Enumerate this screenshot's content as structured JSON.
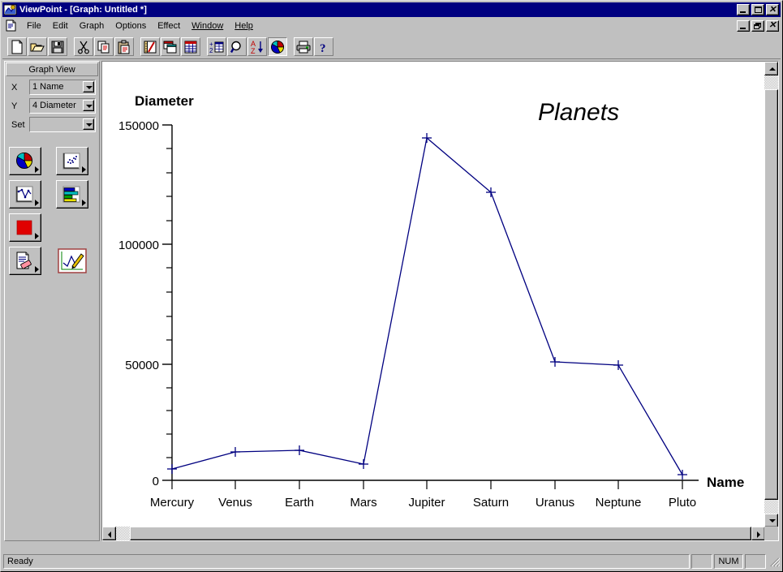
{
  "window": {
    "app_title": "ViewPoint - [Graph: Untitled *]",
    "app_icon": "viewpoint-app-icon",
    "minimize_label": "",
    "maximize_label": "",
    "close_label": "✕"
  },
  "menubar": {
    "document_icon": "document-icon",
    "items": [
      {
        "label": "File",
        "mnemonic": "F"
      },
      {
        "label": "Edit",
        "mnemonic": "E"
      },
      {
        "label": "Graph",
        "mnemonic": "G"
      },
      {
        "label": "Options",
        "mnemonic": "O"
      },
      {
        "label": "Effect",
        "mnemonic": "E"
      },
      {
        "label": "Window",
        "mnemonic": "W"
      },
      {
        "label": "Help",
        "mnemonic": "H"
      }
    ]
  },
  "toolbar": {
    "buttons": [
      {
        "name": "new-document-button",
        "icon": "new-document-icon",
        "pressed": false
      },
      {
        "name": "open-file-button",
        "icon": "open-folder-icon",
        "pressed": false
      },
      {
        "name": "save-button",
        "icon": "floppy-disk-icon",
        "pressed": false
      },
      {
        "name": "cut-button",
        "icon": "scissors-icon",
        "pressed": false
      },
      {
        "name": "copy-button",
        "icon": "copy-pages-icon",
        "pressed": false
      },
      {
        "name": "paste-button",
        "icon": "clipboard-icon",
        "pressed": false
      },
      {
        "name": "design-view-button",
        "icon": "ruler-pencil-icon",
        "pressed": false
      },
      {
        "name": "cascade-windows-button",
        "icon": "cascade-windows-icon",
        "pressed": false
      },
      {
        "name": "table-view-button",
        "icon": "table-grid-icon",
        "pressed": false
      },
      {
        "name": "calculate-button",
        "icon": "calculate-table-icon",
        "pressed": false
      },
      {
        "name": "zoom-button",
        "icon": "magnifier-icon",
        "pressed": false
      },
      {
        "name": "sort-ascending-button",
        "icon": "sort-az-icon",
        "pressed": false
      },
      {
        "name": "graph-view-button",
        "icon": "pie-chart-icon",
        "pressed": true
      },
      {
        "name": "print-button",
        "icon": "printer-icon",
        "pressed": false
      },
      {
        "name": "help-button",
        "icon": "question-mark-icon",
        "pressed": false
      }
    ]
  },
  "sidebar": {
    "header": "Graph View",
    "fields": [
      {
        "label": "X",
        "value": "1 Name",
        "name": "x-axis-field"
      },
      {
        "label": "Y",
        "value": "4 Diameter",
        "name": "y-axis-field"
      },
      {
        "label": "Set",
        "value": "",
        "name": "set-field"
      }
    ],
    "chart_type_buttons": [
      {
        "name": "pie-chart-type-button",
        "icon": "pie-chart-icon",
        "pressed": false
      },
      {
        "name": "scatter-chart-type-button",
        "icon": "scatter-plot-icon",
        "pressed": false
      },
      {
        "name": "line-chart-type-button",
        "icon": "line-chart-icon",
        "pressed": false
      },
      {
        "name": "bar-chart-type-button",
        "icon": "bar-chart-icon",
        "pressed": false
      },
      {
        "name": "area-chart-type-button",
        "icon": "area-chart-icon",
        "pressed": false
      },
      {
        "name": "clear-graph-button",
        "icon": "page-eraser-icon",
        "pressed": false
      },
      {
        "name": "edit-graph-button",
        "icon": "graph-pencil-icon",
        "pressed": false
      }
    ]
  },
  "statusbar": {
    "message": "Ready",
    "panes": [
      "",
      "NUM",
      ""
    ]
  },
  "scrollbars": {
    "vertical": {
      "up_icon": "scroll-up-arrow-icon",
      "down_icon": "scroll-down-arrow-icon"
    },
    "horizontal": {
      "left_icon": "scroll-left-arrow-icon",
      "right_icon": "scroll-right-arrow-icon"
    }
  },
  "colors": {
    "titlebar": "#000080",
    "face": "#c0c0c0",
    "series_line": "#000080",
    "canvas": "#ffffff",
    "axis": "#000000"
  },
  "chart_data": {
    "type": "line",
    "title": "Planets",
    "xlabel": "Name",
    "ylabel": "Diameter",
    "categories": [
      "Mercury",
      "Venus",
      "Earth",
      "Mars",
      "Jupiter",
      "Saturn",
      "Uranus",
      "Neptune",
      "Pluto"
    ],
    "values": [
      4880,
      12100,
      12750,
      6800,
      143000,
      120500,
      51100,
      49500,
      2300
    ],
    "series": [
      {
        "name": "Diameter",
        "values": [
          4880,
          12100,
          12750,
          6800,
          143000,
          120500,
          51100,
          49500,
          2300
        ]
      }
    ],
    "ylim": [
      0,
      155000
    ],
    "y_major_ticks": [
      0,
      50000,
      100000,
      150000
    ],
    "y_major_tick_labels": [
      "0",
      "50000",
      "100000",
      "150000"
    ],
    "y_minor_tick_interval": 10000,
    "grid": false,
    "legend": "none",
    "marker": "plus",
    "line_color": "#000080",
    "marker_color": "#000080"
  }
}
